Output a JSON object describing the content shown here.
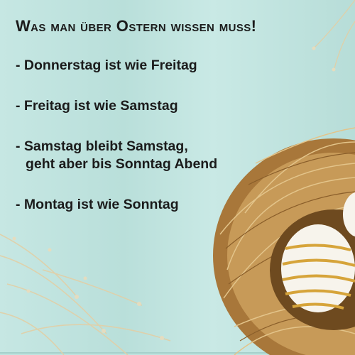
{
  "title": "Was man über Ostern wissen muss!",
  "items": [
    {
      "line1": "- Donnerstag ist wie Freitag"
    },
    {
      "line1": "- Freitag ist wie Samstag"
    },
    {
      "line1": "- Samstag bleibt Samstag,",
      "line2": "geht aber bis Sonntag Abend"
    },
    {
      "line1": "- Montag ist wie Sonntag"
    }
  ],
  "colors": {
    "background": "#bfe3df",
    "text": "#1b1b1b",
    "straw": "#b88a4a",
    "egg_stripe": "#d6a43a"
  },
  "icons": [
    "straw-nest-icon",
    "easter-egg-icon",
    "dried-flowers-icon"
  ]
}
